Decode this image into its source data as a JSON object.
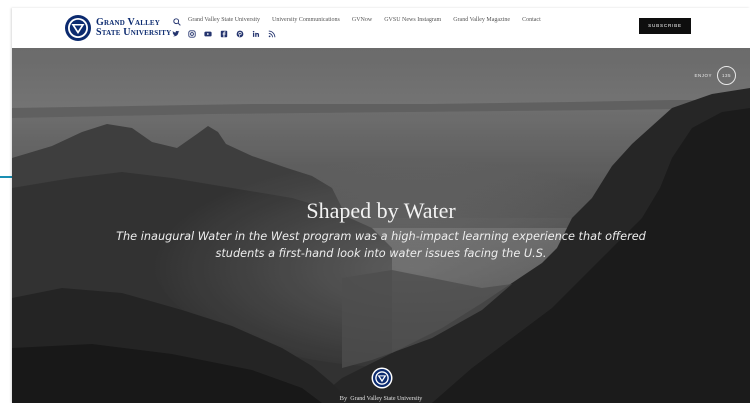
{
  "header": {
    "logo_line1": "Grand Valley",
    "logo_line2": "State University",
    "nav": [
      "Grand Valley State University",
      "University Communications",
      "GVNow",
      "GVSU News Instagram",
      "Grand Valley Magazine",
      "Contact"
    ],
    "social_icons": [
      "twitter-icon",
      "instagram-icon",
      "youtube-icon",
      "facebook-icon",
      "pinterest-icon",
      "linkedin-icon",
      "rss-icon"
    ],
    "subscribe_label": "Subscribe"
  },
  "hero": {
    "enjoy_label": "ENJOY",
    "enjoy_count": "135",
    "title": "Shaped by Water",
    "subtitle": "The inaugural Water in the West program was a high-impact learning experience that offered students a first-hand look into water issues facing the U.S.",
    "by_label": "By",
    "author": "Grand Valley State University"
  },
  "colors": {
    "brand_blue": "#0b2a6f",
    "accent": "#1a8fb3",
    "subscribe_bg": "#0e0e0e"
  }
}
